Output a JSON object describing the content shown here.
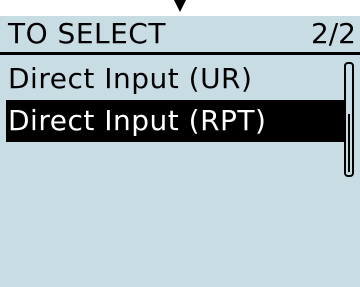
{
  "header": {
    "title": "TO SELECT",
    "page": "2/2"
  },
  "menu": {
    "items": [
      {
        "label": "Direct Input (UR)",
        "selected": false
      },
      {
        "label": "Direct Input (RPT)",
        "selected": true
      }
    ]
  },
  "scrollbar": {
    "position_fraction": 0.5
  },
  "colors": {
    "lcd_background": "#c8dce4",
    "selected_background": "#000000",
    "selected_text": "#ffffff",
    "text": "#000000"
  },
  "icons": {
    "top_pointer": "down-arrow-pointer-icon"
  }
}
